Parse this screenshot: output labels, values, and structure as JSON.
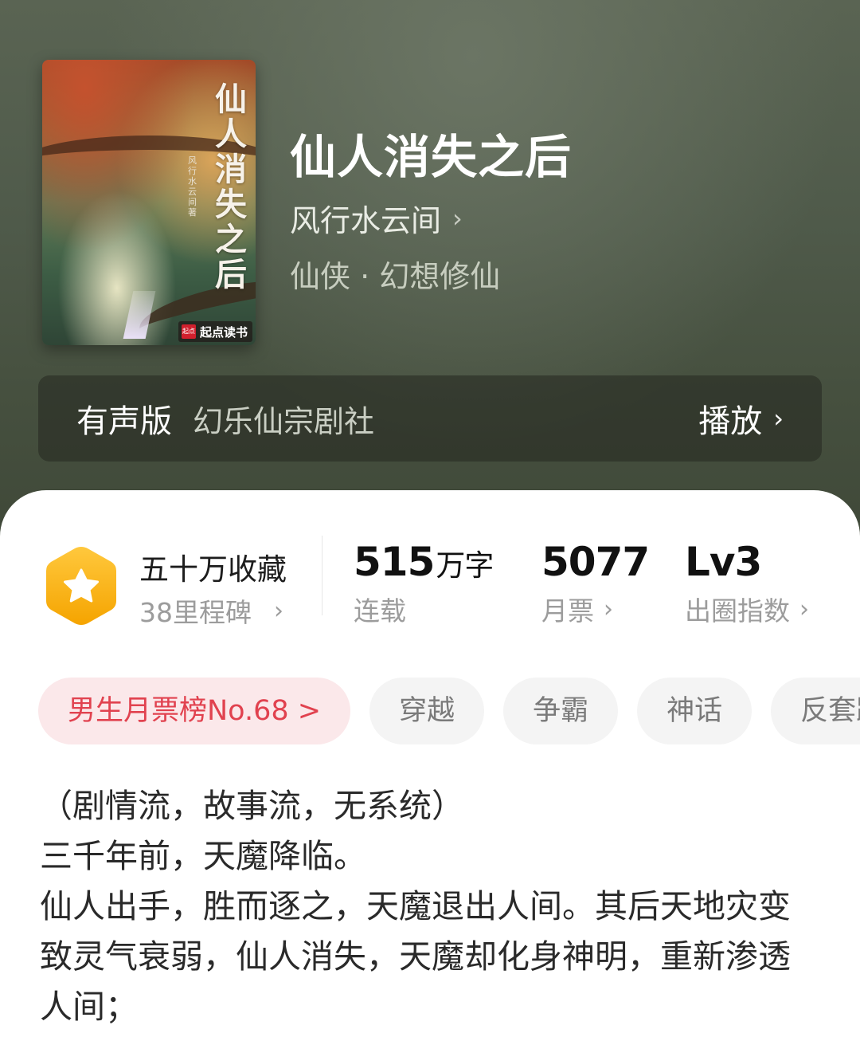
{
  "book": {
    "title": "仙人消失之后",
    "author": "风行水云间",
    "genre": "仙侠 · 幻想修仙",
    "chevron": "›"
  },
  "cover": {
    "title": "仙人消失之后",
    "author_text": "风行水云间 著",
    "badge_logo": "起点",
    "badge_text": "起点读书"
  },
  "audio": {
    "label": "有声版",
    "troupe": "幻乐仙宗剧社",
    "play": "播放",
    "chevron": "›"
  },
  "stats": {
    "collect_title": "五十万收藏",
    "collect_sub": "38里程碑",
    "words_value": "515",
    "words_unit": "万字",
    "words_label": "连载",
    "votes_value": "5077",
    "votes_label": "月票",
    "level_value": "Lv3",
    "level_label": "出圈指数",
    "chevron": "›",
    "badge_icon": "star-hexagon-icon",
    "badge_color": "#f8b21a"
  },
  "tags": [
    "男生月票榜No.68 >",
    "穿越",
    "争霸",
    "神话",
    "反套路"
  ],
  "intro": [
    "（剧情流，故事流，无系统）",
    "三千年前，天魔降临。",
    "仙人出手，胜而逐之，天魔退出人间。其后天地灾变致灵气衰弱，仙人消失，天魔却化身神明，重新渗透人间；"
  ]
}
